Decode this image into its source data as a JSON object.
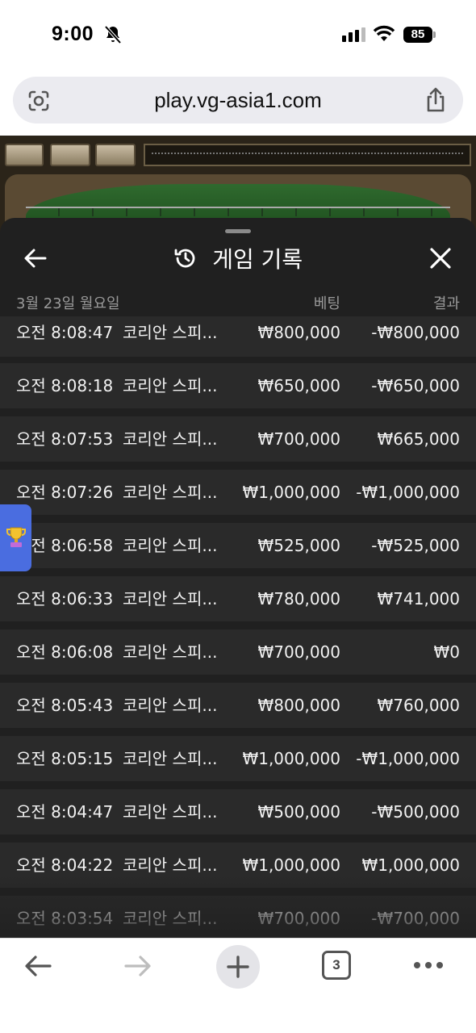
{
  "status_bar": {
    "time": "9:00",
    "battery": "85"
  },
  "browser": {
    "url": "play.vg-asia1.com",
    "tab_count": "3"
  },
  "panel": {
    "title": "게임 기록",
    "date_header": "3월 23일 월요일",
    "bet_header": "베팅",
    "result_header": "결과"
  },
  "rows": [
    {
      "time": "오전 8:08:47",
      "game": "코리안 스피...",
      "bet": "₩800,000",
      "result": "-₩800,000"
    },
    {
      "time": "오전 8:08:18",
      "game": "코리안 스피...",
      "bet": "₩650,000",
      "result": "-₩650,000"
    },
    {
      "time": "오전 8:07:53",
      "game": "코리안 스피...",
      "bet": "₩700,000",
      "result": "₩665,000"
    },
    {
      "time": "오전 8:07:26",
      "game": "코리안 스피...",
      "bet": "₩1,000,000",
      "result": "-₩1,000,000"
    },
    {
      "time": "오전 8:06:58",
      "game": "코리안 스피...",
      "bet": "₩525,000",
      "result": "-₩525,000"
    },
    {
      "time": "오전 8:06:33",
      "game": "코리안 스피...",
      "bet": "₩780,000",
      "result": "₩741,000"
    },
    {
      "time": "오전 8:06:08",
      "game": "코리안 스피...",
      "bet": "₩700,000",
      "result": "₩0"
    },
    {
      "time": "오전 8:05:43",
      "game": "코리안 스피...",
      "bet": "₩800,000",
      "result": "₩760,000"
    },
    {
      "time": "오전 8:05:15",
      "game": "코리안 스피...",
      "bet": "₩1,000,000",
      "result": "-₩1,000,000"
    },
    {
      "time": "오전 8:04:47",
      "game": "코리안 스피...",
      "bet": "₩500,000",
      "result": "-₩500,000"
    },
    {
      "time": "오전 8:04:22",
      "game": "코리안 스피...",
      "bet": "₩1,000,000",
      "result": "₩1,000,000"
    },
    {
      "time": "오전 8:03:54",
      "game": "코리안 스피...",
      "bet": "₩700,000",
      "result": "-₩700,000"
    }
  ],
  "icons": {
    "status": [
      "bell-off-icon",
      "signal-icon",
      "wifi-icon",
      "battery-icon"
    ],
    "browser": [
      "lens-icon",
      "share-icon"
    ],
    "panel": [
      "back-arrow-icon",
      "history-icon",
      "close-icon"
    ],
    "floating": "trophy-icon",
    "toolbar": [
      "back-icon",
      "forward-icon",
      "plus-icon",
      "tabs-icon",
      "more-icon"
    ]
  }
}
